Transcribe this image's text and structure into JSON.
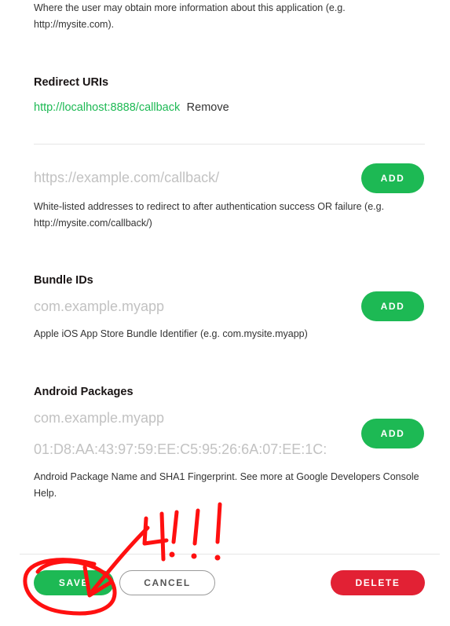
{
  "website": {
    "help_text": "Where the user may obtain more information about this application (e.g. http://mysite.com)."
  },
  "redirect_uris": {
    "title": "Redirect URIs",
    "existing_uri": "http://localhost:8888/callback",
    "remove_label": "Remove",
    "input_placeholder": "https://example.com/callback/",
    "add_label": "ADD",
    "help_text": "White-listed addresses to redirect to after authentication success OR failure (e.g. http://mysite.com/callback/)"
  },
  "bundle_ids": {
    "title": "Bundle IDs",
    "input_placeholder": "com.example.myapp",
    "add_label": "ADD",
    "help_text": "Apple iOS App Store Bundle Identifier (e.g. com.mysite.myapp)"
  },
  "android_packages": {
    "title": "Android Packages",
    "package_placeholder": "com.example.myapp",
    "fingerprint_placeholder": "01:D8:AA:43:97:59:EE:C5:95:26:6A:07:EE:1C:",
    "add_label": "ADD",
    "help_text": "Android Package Name and SHA1 Fingerprint. See more at Google Developers Console Help."
  },
  "footer": {
    "save_label": "SAVE",
    "cancel_label": "CANCEL",
    "delete_label": "DELETE"
  },
  "annotation": {
    "scribble_text": "4!!!",
    "color": "#ff1010"
  },
  "colors": {
    "accent_green": "#1db954",
    "danger_red": "#e22134"
  }
}
